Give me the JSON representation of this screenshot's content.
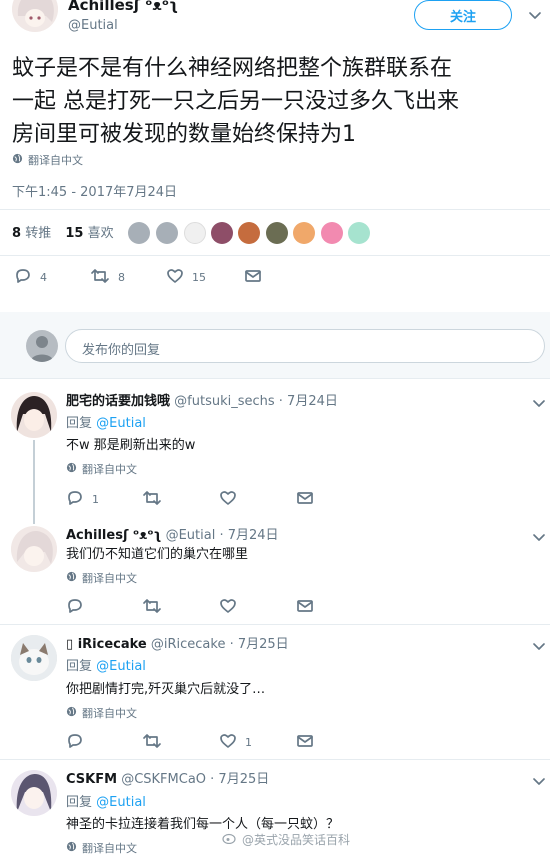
{
  "tweet": {
    "author_name": "Achillesʃ ᵒᴥᵒʅ",
    "author_handle": "@Eutial",
    "follow_label": "关注",
    "text": "蚊子是不是有什么神经网络把整个族群联系在\n一起 总是打死一只之后另一只没过多久飞出来\n房间里可被发现的数量始终保持为1",
    "translate_label": "翻译自中文",
    "timestamp": "下午1:45 - 2017年7月24日",
    "retweet_count": "8",
    "retweet_label": "转推",
    "like_count": "15",
    "like_label": "喜欢",
    "actions": {
      "reply_count": "4",
      "retweet_count": "8",
      "like_count": "15"
    }
  },
  "reply_box": {
    "placeholder": "发布你的回复"
  },
  "replies": [
    {
      "name": "肥宅的话要加钱哦",
      "handle": "@futsuki_sechs",
      "date": "· 7月24日",
      "reply_to_prefix": "回复",
      "reply_to": "@Eutial",
      "text": "不w 那是刷新出来的w",
      "translate": "翻译自中文",
      "reply_count": "1",
      "retweet_count": "",
      "like_count": ""
    },
    {
      "name": "Achillesʃ ᵒᴥᵒʅ",
      "handle": "@Eutial",
      "date": "· 7月24日",
      "text": "我们仍不知道它们的巢穴在哪里",
      "translate": "翻译自中文",
      "reply_count": "",
      "retweet_count": "",
      "like_count": ""
    },
    {
      "name": "iRicecake",
      "handle": "@iRicecake",
      "date": "· 7月25日",
      "reply_to_prefix": "回复",
      "reply_to": "@Eutial",
      "text": "你把剧情打完,歼灭巢穴后就没了…",
      "translate": "翻译自中文",
      "reply_count": "",
      "retweet_count": "",
      "like_count": "1"
    },
    {
      "name": "CSKFM",
      "handle": "@CSKFMCaO",
      "date": "· 7月25日",
      "reply_to_prefix": "回复",
      "reply_to": "@Eutial",
      "text": "神圣的卡拉连接着我们每一个人（每一只蚊）？",
      "translate": "翻译自中文"
    }
  ],
  "watermark": "@英式没品笑话百科",
  "colors": {
    "accent": "#1da1f2",
    "muted": "#657786",
    "divider": "#e6ecf0"
  }
}
